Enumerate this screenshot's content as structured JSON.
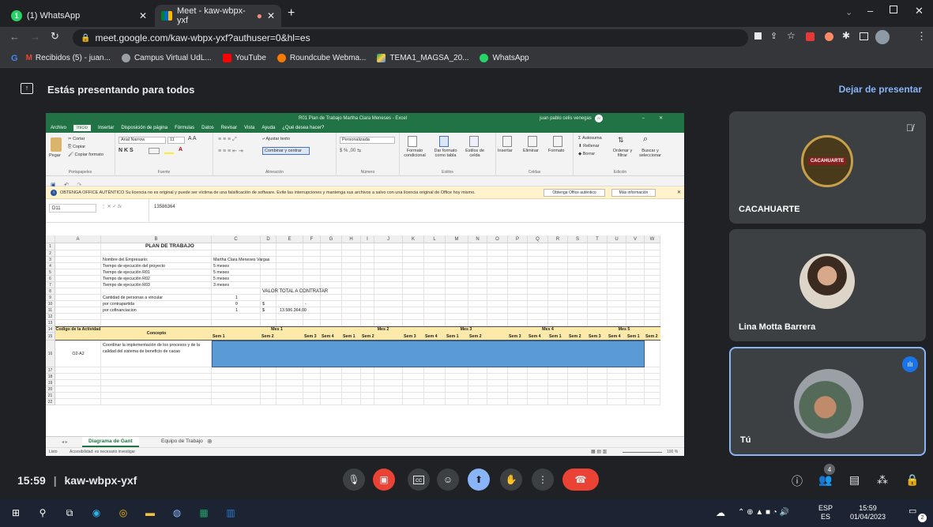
{
  "browser": {
    "tabs": [
      {
        "label": "(1) WhatsApp",
        "badge": "1"
      },
      {
        "label": "Meet - kaw-wbpx-yxf"
      }
    ],
    "url": "meet.google.com/kaw-wbpx-yxf?authuser=0&hl=es",
    "bookmarks": [
      "Recibidos (5) - juan...",
      "Campus Virtual UdL...",
      "YouTube",
      "Roundcube Webma...",
      "TEMA1_MAGSA_20...",
      "WhatsApp"
    ]
  },
  "meet": {
    "presenting_text": "Estás presentando para todos",
    "stop_presenting": "Dejar de presentar",
    "time": "15:59",
    "meeting_code": "kaw-wbpx-yxf",
    "people_count": "4",
    "participants": [
      {
        "name": "CACAHUARTE",
        "logo_text": "CACAHUARTE"
      },
      {
        "name": "Lina Motta Barrera"
      },
      {
        "name": "Tú"
      }
    ]
  },
  "excel": {
    "title": "R01 Plan de Trabajo Martha Clara Meneses - Excel",
    "user": "juan pablo celis venegas",
    "user_initials": "JV",
    "menu": [
      "Archivo",
      "Inicio",
      "Insertar",
      "Disposición de página",
      "Fórmulas",
      "Datos",
      "Revisar",
      "Vista",
      "Ayuda",
      "¿Qué desea hacer?"
    ],
    "ribbon": {
      "clipboard": {
        "paste": "Pegar",
        "cut": "Cortar",
        "copy": "Copiar",
        "format_painter": "Copiar formato",
        "group": "Portapapeles"
      },
      "font": {
        "name": "Arial Narrow",
        "size": "11",
        "group": "Fuente"
      },
      "alignment": {
        "wrap": "Ajustar texto",
        "merge": "Combinar y centrar",
        "group": "Alineación"
      },
      "number": {
        "format": "Personalizada",
        "group": "Número"
      },
      "styles": {
        "conditional": "Formato condicional",
        "table": "Dar formato como tabla",
        "cell_styles": "Estilos de celda",
        "group": "Estilos"
      },
      "cells": {
        "insert": "Insertar",
        "delete": "Eliminar",
        "format": "Formato",
        "group": "Celdas"
      },
      "editing": {
        "autosum": "Autosuma",
        "fill": "Rellenar",
        "clear": "Borrar",
        "sort": "Ordenar y filtrar",
        "find": "Buscar y seleccionar",
        "group": "Edición"
      }
    },
    "warning": {
      "text": "OBTENGA OFFICE AUTÉNTICO  Su licencia no es original y puede ser víctima de una falsificación de software. Evite las interrupciones y mantenga sus archivos a salvo con una licencia original de Office hoy mismo.",
      "btn1": "Obtenga Office auténtico",
      "btn2": "Más información"
    },
    "name_box": "D11",
    "formula": "13586364",
    "columns": [
      "A",
      "B",
      "C",
      "D",
      "E",
      "F",
      "G",
      "H",
      "I",
      "J",
      "K",
      "L",
      "M",
      "N",
      "O",
      "P",
      "Q",
      "R",
      "S",
      "T",
      "U",
      "V",
      "W"
    ],
    "rows": [
      "1",
      "2",
      "3",
      "4",
      "5",
      "6",
      "7",
      "8",
      "9",
      "10",
      "11",
      "12",
      "13",
      "14",
      "15",
      "16",
      "17",
      "18",
      "19",
      "20",
      "21",
      "22"
    ],
    "sheet": {
      "plan_title": "PLAN DE TRABAJO",
      "labels": [
        "Nombre del Empresario:",
        "Tiempo de ejecución del proyecto",
        "Tiempo de ejecución R01",
        "Tiempo de ejecución R02",
        "Tiempo de ejecución R03"
      ],
      "values": [
        "Martha Clara Meneses Vargas",
        "5 meses",
        "5 meses",
        "5 meses",
        "3 meses"
      ],
      "valor_total": "VALOR TOTAL A CONTRATAR",
      "personas_label": "Cantidad de personas a vincular",
      "personas_val": "1",
      "contrapartida_label": "por contrapartida",
      "contrapartida_val": "0",
      "cofinanciacion_label": "por cofinanciacion",
      "cofinanciacion_val": "1",
      "currency": "$",
      "dash": "-",
      "amount": "13.586.364,00",
      "h_codigo": "Codigo de la Actividad",
      "h_concepto": "Concepto",
      "months": [
        "Mes 1",
        "Mes 2",
        "Mes 3",
        "Mes 4",
        "Mes 5"
      ],
      "weeks": [
        "Sem 1",
        "Sem 2",
        "Sem 3",
        "Sem 4"
      ],
      "activity_code": "O2-A2",
      "activity_text": "Coordinar la implementación de los procesos y de la calidad del sistema de beneficio de cacao"
    },
    "sheet_tabs": [
      "Diagrama de Gant",
      "Equipo de Trabajo"
    ],
    "status_left": "Listo",
    "status_access": "Accesibilidad: es necesario investigar",
    "zoom": "100 %"
  },
  "taskbar": {
    "lang1": "ESP",
    "lang2": "ES",
    "time": "15:59",
    "date": "01/04/2023",
    "notif": "2"
  }
}
